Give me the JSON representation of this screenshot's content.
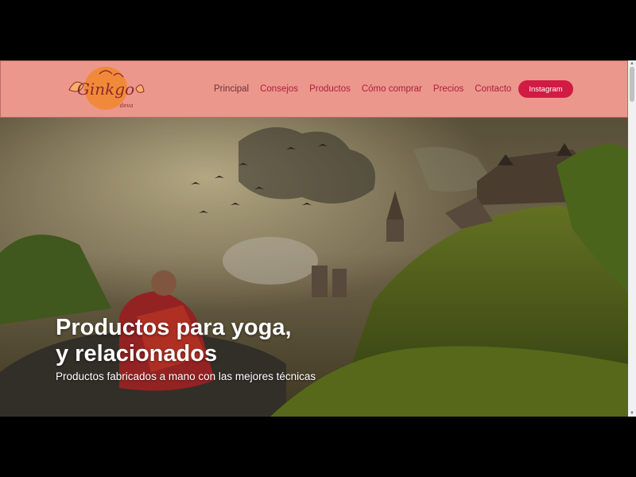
{
  "header": {
    "logo_text": "Ginkgo",
    "logo_subtext": "deva",
    "nav": [
      {
        "label": "Principal",
        "active": true
      },
      {
        "label": "Consejos",
        "active": false
      },
      {
        "label": "Productos",
        "active": false
      },
      {
        "label": "Cómo comprar",
        "active": false
      },
      {
        "label": "Precios",
        "active": false
      },
      {
        "label": "Contacto",
        "active": false
      }
    ],
    "cta_label": "Instagram"
  },
  "hero": {
    "title_line1": "Productos para yoga,",
    "title_line2": "y relacionados",
    "subtitle": "Productos fabricados a mano con las mejores técnicas",
    "image_desc_icon": "meditating-monk-mountain-castle"
  },
  "colors": {
    "header_bg": "#eb978c",
    "nav_text": "#b11c3f",
    "nav_active": "#6a3437",
    "cta_bg": "#d11b43"
  }
}
